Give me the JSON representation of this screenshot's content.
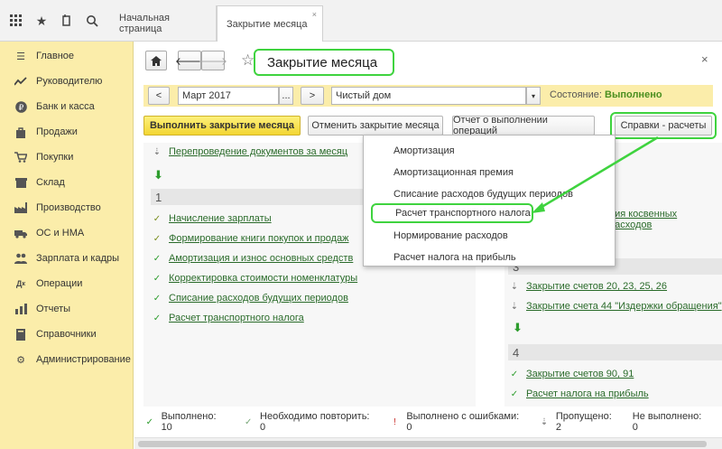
{
  "topbar": {
    "tabs": [
      {
        "label": "Начальная страница"
      },
      {
        "label": "Закрытие месяца",
        "close": "×"
      }
    ]
  },
  "sidebar": {
    "items": [
      {
        "label": "Главное",
        "icon": "menu-icon"
      },
      {
        "label": "Руководителю",
        "icon": "chart-line-icon"
      },
      {
        "label": "Банк и касса",
        "icon": "ruble-icon"
      },
      {
        "label": "Продажи",
        "icon": "bag-icon"
      },
      {
        "label": "Покупки",
        "icon": "cart-icon"
      },
      {
        "label": "Склад",
        "icon": "box-icon"
      },
      {
        "label": "Производство",
        "icon": "factory-icon"
      },
      {
        "label": "ОС и НМА",
        "icon": "car-icon"
      },
      {
        "label": "Зарплата и кадры",
        "icon": "people-icon"
      },
      {
        "label": "Операции",
        "icon": "dt-kt-icon"
      },
      {
        "label": "Отчеты",
        "icon": "report-icon"
      },
      {
        "label": "Справочники",
        "icon": "book-icon"
      },
      {
        "label": "Администрирование",
        "icon": "gear-icon"
      }
    ]
  },
  "header": {
    "title": "Закрытие месяца",
    "close": "×"
  },
  "filter": {
    "prev": "<",
    "period": "Март 2017",
    "period_btn": "...",
    "next": ">",
    "org": "Чистый дом",
    "status_label": "Состояние:",
    "status_value": "Выполнено",
    "colors": {
      "status": "#4a8f1f",
      "highlight": "#3fd33f",
      "accent": "#fbe46f"
    }
  },
  "actions": {
    "run": "Выполнить закрытие месяца",
    "cancel": "Отменить закрытие месяца",
    "report": "Отчет о выполнении операций",
    "help": "Справки - расчеты"
  },
  "left": {
    "pre_op": "Перепроведение документов за месяц",
    "step": "1",
    "ops": [
      "Начисление зарплаты",
      "Формирование книги покупок и продаж",
      "Амортизация и износ основных средств",
      "Корректировка стоимости номенклатуры",
      "Списание расходов будущих периодов",
      "Расчет транспортного налога"
    ]
  },
  "right": {
    "partial_op": "ния косвенных расходов",
    "step3": "3",
    "ops3": [
      "Закрытие счетов 20, 23, 25, 26",
      "Закрытие счета 44 \"Издержки обращения\""
    ],
    "step4": "4",
    "ops4": [
      "Закрытие счетов 90, 91",
      "Расчет налога на прибыль"
    ]
  },
  "popup": {
    "items": [
      "Амортизация",
      "Амортизационная премия",
      "Списание расходов будущих периодов",
      "Расчет транспортного налога",
      "Нормирование расходов",
      "Расчет налога на прибыль"
    ]
  },
  "footer": {
    "done": "Выполнено: 10",
    "repeat": "Необходимо повторить: 0",
    "errors": "Выполнено с ошибками: 0",
    "skipped": "Пропущено: 2",
    "not_done": "Не выполнено: 0"
  }
}
